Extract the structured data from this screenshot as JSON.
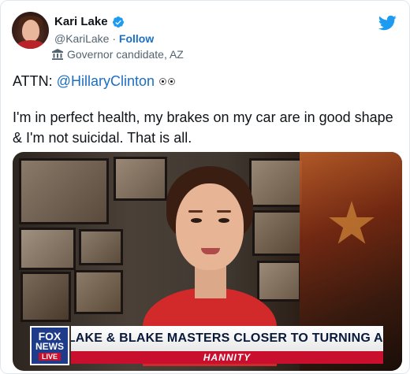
{
  "tweet": {
    "author": {
      "name": "Kari Lake",
      "verified": true,
      "handle": "@KariLake",
      "separator": "·",
      "follow_label": "Follow",
      "label": "Governor candidate, AZ",
      "label_icon": "government-building-icon"
    },
    "brand_icon": "twitter-bird-icon",
    "text_line1_prefix": "ATTN: ",
    "mention": "@HillaryClinton",
    "emoji": "eyes-emoji",
    "text_body": "I'm in perfect health, my brakes on my car are in good shape & I'm not suicidal. That is all.",
    "media": {
      "network_logo_line1": "FOX",
      "network_logo_line2": "NEWS",
      "network_logo_live": "LIVE",
      "chyron_headline": "KARI LAKE & BLAKE MASTERS CLOSER TO TURNING AZ RED",
      "chyron_show": "HANNITY"
    }
  },
  "colors": {
    "link": "#1b6fc2",
    "twitter_blue": "#1d9bf0",
    "fox_blue": "#1f3c8a",
    "fox_red": "#c8102e"
  }
}
